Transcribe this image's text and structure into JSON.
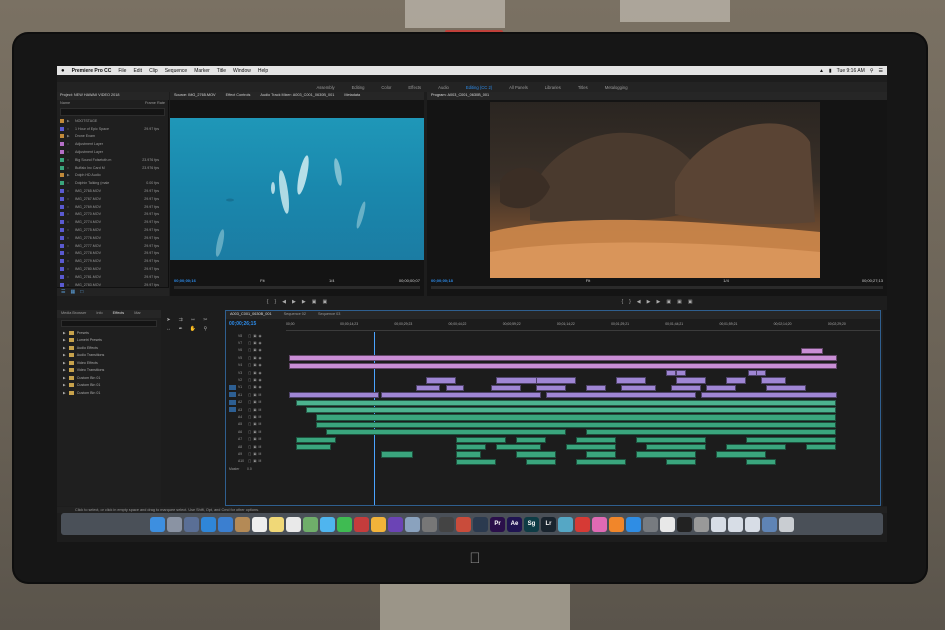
{
  "menubar": {
    "app_name": "Premiere Pro CC",
    "items": [
      "File",
      "Edit",
      "Clip",
      "Sequence",
      "Marker",
      "Title",
      "Window",
      "Help"
    ],
    "clock": "Tue 9:16 AM"
  },
  "workspaces": [
    "Assembly",
    "Editing",
    "Color",
    "Effects",
    "Audio",
    "Editing (CC 2)",
    "All Panels",
    "Libraries",
    "Titles",
    "Metalogging"
  ],
  "active_workspace": "Editing (CC 2)",
  "project": {
    "title": "Project: NEW HAWAII VIDEO 2018",
    "columns": {
      "name": "Name",
      "fps": "Frame Rate"
    },
    "items": [
      {
        "name": "NOOTSTAGE",
        "fps": "",
        "color": "#c28a3a",
        "folder": true
      },
      {
        "name": "1 Hour of Epic Space",
        "fps": "29.97 fps",
        "color": "#5a5ad1"
      },
      {
        "name": "Drone Exam",
        "fps": "",
        "color": "#c28a3a",
        "folder": true
      },
      {
        "name": "Adjustment Layer",
        "fps": "",
        "color": "#b56fc7"
      },
      {
        "name": "Adjustment Layer",
        "fps": "",
        "color": "#b56fc7"
      },
      {
        "name": "Big Sound Folsetoth.m",
        "fps": "23.976 fps",
        "color": "#3aa57d"
      },
      {
        "name": "Buffalo Inc Card M",
        "fps": "23.976 fps",
        "color": "#3aa57d"
      },
      {
        "name": "Dolph HD Audio",
        "fps": "",
        "color": "#c28a3a",
        "folder": true
      },
      {
        "name": "Dolphin Talking (male",
        "fps": "0.00 fps",
        "color": "#3aa57d"
      },
      {
        "name": "IMG_2765.MOV",
        "fps": "29.97 fps",
        "color": "#5a5ad1"
      },
      {
        "name": "IMG_2767.MOV",
        "fps": "29.97 fps",
        "color": "#5a5ad1"
      },
      {
        "name": "IMG_2769.MOV",
        "fps": "29.97 fps",
        "color": "#5a5ad1"
      },
      {
        "name": "IMG_2770.MOV",
        "fps": "29.97 fps",
        "color": "#5a5ad1"
      },
      {
        "name": "IMG_2774.MOV",
        "fps": "29.97 fps",
        "color": "#5a5ad1"
      },
      {
        "name": "IMG_2775.MOV",
        "fps": "29.97 fps",
        "color": "#5a5ad1"
      },
      {
        "name": "IMG_2776.MOV",
        "fps": "29.97 fps",
        "color": "#5a5ad1"
      },
      {
        "name": "IMG_2777.MOV",
        "fps": "29.97 fps",
        "color": "#5a5ad1"
      },
      {
        "name": "IMG_2778.MOV",
        "fps": "29.97 fps",
        "color": "#5a5ad1"
      },
      {
        "name": "IMG_2779.MOV",
        "fps": "29.97 fps",
        "color": "#5a5ad1"
      },
      {
        "name": "IMG_2780.MOV",
        "fps": "29.97 fps",
        "color": "#5a5ad1"
      },
      {
        "name": "IMG_2781.MOV",
        "fps": "29.97 fps",
        "color": "#5a5ad1"
      },
      {
        "name": "IMG_2783.MOV",
        "fps": "29.97 fps",
        "color": "#5a5ad1"
      }
    ]
  },
  "source_monitor": {
    "tabs": [
      "Source: IMG_2765.MOV",
      "Effect Controls",
      "Audio Track Mixer: A003_C001_0630B_001",
      "Metadata"
    ],
    "timecode_in": "00;00;00;16",
    "fit": "Fit",
    "scale": "1/4",
    "timecode_out": "00;00;00;07"
  },
  "program_monitor": {
    "tab": "Program: A003_C001_0630B_001",
    "timecode_in": "00;00;00;18",
    "fit": "Fit",
    "scale": "1/4",
    "timecode_out": "00;00;27;13"
  },
  "effects_panel": {
    "tabs": [
      "Media Browser",
      "Info",
      "Effects",
      "Mar"
    ],
    "active_tab": "Effects",
    "items": [
      "Presets",
      "Lumetri Presets",
      "Audio Effects",
      "Audio Transitions",
      "Video Effects",
      "Video Transitions",
      "Custom Bin 01",
      "Custom Bin 01",
      "Custom Bin 01"
    ]
  },
  "timeline": {
    "tabs": [
      "A003_C001_0630B_001",
      "Sequence 02",
      "Sequence 03"
    ],
    "active_tab": "A003_C001_0630B_001",
    "timecode": "00;00;26;15",
    "ruler": [
      "00;00",
      "00;00;14;23",
      "00;00;29;23",
      "00;00;44;22",
      "00;00;59;22",
      "00;01;14;22",
      "00;01;29;21",
      "00;01;44;21",
      "00;01;59;21",
      "00;02;14;20",
      "00;02;29;20"
    ],
    "video_tracks": [
      "V8",
      "V7",
      "V6",
      "V5",
      "V4",
      "V3",
      "V2",
      "V1"
    ],
    "audio_tracks": [
      "A1",
      "A2",
      "A3",
      "A4",
      "A5",
      "A6",
      "A7",
      "A8",
      "A9",
      "A10"
    ],
    "master_label": "Master",
    "master_value": "0.0",
    "clip_labels": {
      "title": "Title 01",
      "adjustment": "Adjustment Layer",
      "video": "A003_C004",
      "long_video": "A003_C1047_0630B_001 [V]"
    }
  },
  "status_bar": "Click to select, or click in empty space and drag to marquee select. Use Shift, Opt, and Cmd for other options.",
  "dock": [
    {
      "name": "finder-icon",
      "label": "",
      "color": "#3d8fe0"
    },
    {
      "name": "launchpad-icon",
      "label": "",
      "color": "#8a93a3"
    },
    {
      "name": "rocket-icon",
      "label": "",
      "color": "#5a6f96"
    },
    {
      "name": "safari-icon",
      "label": "",
      "color": "#2f86d8"
    },
    {
      "name": "mail-icon",
      "label": "",
      "color": "#3b7fd0"
    },
    {
      "name": "contacts-icon",
      "label": "",
      "color": "#b48a56"
    },
    {
      "name": "calendar-icon",
      "label": "",
      "color": "#eeeeee"
    },
    {
      "name": "notes-icon",
      "label": "",
      "color": "#f0d877"
    },
    {
      "name": "reminders-icon",
      "label": "",
      "color": "#e9e9e9"
    },
    {
      "name": "maps-icon",
      "label": "",
      "color": "#6fae6a"
    },
    {
      "name": "messages-icon",
      "label": "",
      "color": "#4fb5ef"
    },
    {
      "name": "facetime-icon",
      "label": "",
      "color": "#3fbb52"
    },
    {
      "name": "photobooth-icon",
      "label": "",
      "color": "#c53c3c"
    },
    {
      "name": "photos-icon",
      "label": "",
      "color": "#f2b33a"
    },
    {
      "name": "imovie-icon",
      "label": "",
      "color": "#6b44b5"
    },
    {
      "name": "preview-icon",
      "label": "",
      "color": "#8aa2be"
    },
    {
      "name": "image-capture-icon",
      "label": "",
      "color": "#777777"
    },
    {
      "name": "dvd-icon",
      "label": "",
      "color": "#444444"
    },
    {
      "name": "photo-icon",
      "label": "",
      "color": "#c94c3b"
    },
    {
      "name": "steam-icon",
      "label": "",
      "color": "#2b3a4f"
    },
    {
      "name": "premiere-icon",
      "label": "Pr",
      "color": "#2a0f4a"
    },
    {
      "name": "after-effects-icon",
      "label": "Ae",
      "color": "#1f1451"
    },
    {
      "name": "speedgrade-icon",
      "label": "Sg",
      "color": "#0e3c45"
    },
    {
      "name": "lightroom-icon",
      "label": "Lr",
      "color": "#19242e"
    },
    {
      "name": "network-icon",
      "label": "",
      "color": "#55a7c5"
    },
    {
      "name": "creative-cloud-icon",
      "label": "",
      "color": "#d63a35"
    },
    {
      "name": "itunes-icon",
      "label": "",
      "color": "#e06ab4"
    },
    {
      "name": "ibooks-icon",
      "label": "",
      "color": "#f1862a"
    },
    {
      "name": "app-store-icon",
      "label": "",
      "color": "#2f8de4"
    },
    {
      "name": "system-preferences-icon",
      "label": "",
      "color": "#777b80"
    },
    {
      "name": "textedit-icon",
      "label": "",
      "color": "#e8e8e8"
    },
    {
      "name": "terminal-icon",
      "label": "",
      "color": "#222222"
    },
    {
      "name": "screenshot-icon",
      "label": "",
      "color": "#999999"
    },
    {
      "name": "document-icon",
      "label": "",
      "color": "#d7dde6"
    },
    {
      "name": "document-icon-2",
      "label": "",
      "color": "#d7dde6"
    },
    {
      "name": "document-icon-3",
      "label": "",
      "color": "#d7dde6"
    },
    {
      "name": "downloads-icon",
      "label": "",
      "color": "#5f84b5"
    },
    {
      "name": "trash-icon",
      "label": "",
      "color": "#c9cdd2"
    }
  ]
}
